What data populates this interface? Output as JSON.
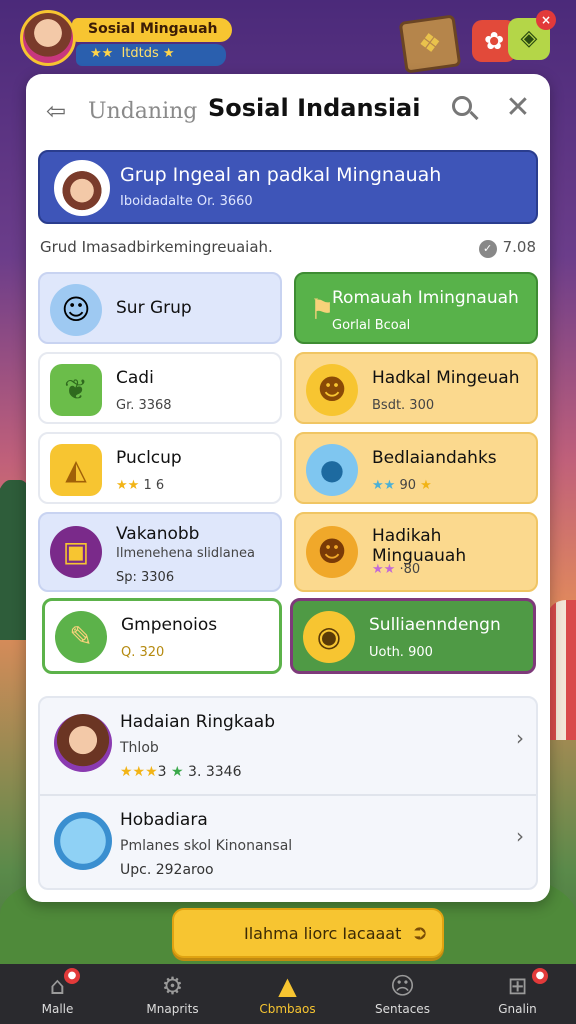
{
  "profile": {
    "name": "Sosial Mingauah",
    "sub": "Itdtds",
    "stars": "★★",
    "star_end": "★"
  },
  "top_actions": {
    "gift_icon": "gift-box-icon",
    "chat_badge": "×"
  },
  "header": {
    "back_label": "Undaning",
    "title": "Sosial Indansiai"
  },
  "banner": {
    "title": "Grup Ingeal an padkal Mingnauah",
    "subtitle": "Iboidadalte Or. 3660"
  },
  "info": {
    "text": "Grud Imasadbirkemingreuaiah.",
    "count": "7.08"
  },
  "cards": [
    {
      "title": "Sur Grup",
      "sub": ""
    },
    {
      "title": "Romauah Imingnauah",
      "sub": "Gorlal Bcoal"
    },
    {
      "title": "Cadi",
      "sub": "Gr. 3368"
    },
    {
      "title": "Hadkal Mingeuah",
      "sub": "Bsdt. 300"
    },
    {
      "title": "Puclcup",
      "sub": "1 6",
      "stars": "★★"
    },
    {
      "title": "Bedlaiandahks",
      "sub": "90",
      "stars": "★★",
      "star_end": "★"
    },
    {
      "title": "Vakanobb",
      "sub": "Ilmenehena slidlanea",
      "sub2": "Sp: 3306"
    },
    {
      "title": "Hadikah Minguauah",
      "sub": "·80",
      "stars": "★★"
    },
    {
      "title": "Gmpenoios",
      "sub": "Q. 320"
    },
    {
      "title": "Sulliaenndengn",
      "sub": "Uoth. 900"
    }
  ],
  "list": [
    {
      "title": "Hadaian Ringkaab",
      "sub": "Thlob",
      "stars": "★★★",
      "count_a": "3",
      "count_b": "3. 3346",
      "chev": "›"
    },
    {
      "title": "Hobadiara",
      "sub": "Pmlanes skol Kinonansal",
      "sub2": "Upc. 292aroo",
      "chev": "›"
    }
  ],
  "cta": {
    "label": "Ilahma liorc Iacaaat",
    "arrow": "➲"
  },
  "nav": [
    {
      "label": "Malle",
      "icon": "home-icon"
    },
    {
      "label": "Mnaprits",
      "icon": "settings-icon"
    },
    {
      "label": "Cbmbaos",
      "icon": "tent-icon"
    },
    {
      "label": "Sentaces",
      "icon": "face-icon"
    },
    {
      "label": "Gnalin",
      "icon": "gamepad-icon"
    }
  ]
}
